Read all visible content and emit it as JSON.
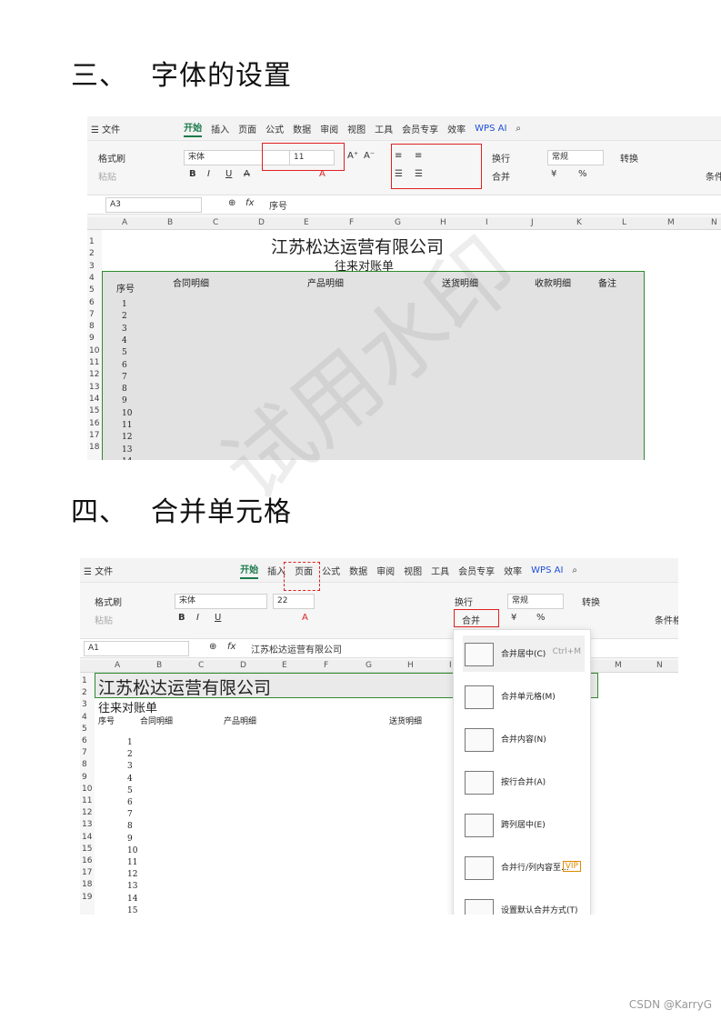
{
  "section1": {
    "num": "三、",
    "title": "字体的设置"
  },
  "section2": {
    "num": "四、",
    "title": "合并单元格"
  },
  "ribbon": {
    "menu": "☰ 文件",
    "tabs": [
      "开始",
      "插入",
      "页面",
      "公式",
      "数据",
      "审阅",
      "视图",
      "工具",
      "会员专享",
      "效率"
    ],
    "wps_ai": "WPS AI",
    "format_painter": "格式刷",
    "paste": "粘贴",
    "font_name": "宋体",
    "font_size": "11",
    "font_size_2": "22",
    "wrap": "换行",
    "merge": "合并",
    "number_format": "常规",
    "convert": "转换",
    "cond_format": "条件格",
    "yen": "¥",
    "percent": "%"
  },
  "shot1": {
    "name_box": "A3",
    "fx": "fx",
    "formula": "序号",
    "columns": [
      "A",
      "B",
      "C",
      "D",
      "E",
      "F",
      "G",
      "H",
      "I",
      "J",
      "K",
      "L",
      "M",
      "N"
    ],
    "title": "江苏松达运营有限公司",
    "subtitle": "往来对账单",
    "headers": [
      "序号",
      "合同明细",
      "产品明细",
      "送货明细",
      "收款明细",
      "备注"
    ],
    "rows": [
      "1",
      "2",
      "3",
      "4",
      "5",
      "6",
      "7",
      "8",
      "9",
      "10",
      "11",
      "12",
      "13",
      "14",
      "15",
      "16",
      "17",
      "18"
    ],
    "numbers": [
      "1",
      "2",
      "3",
      "4",
      "5",
      "6",
      "7",
      "8",
      "9",
      "10",
      "11",
      "12",
      "13",
      "14"
    ]
  },
  "shot2": {
    "name_box": "A1",
    "fx": "fx",
    "formula": "江苏松达运营有限公司",
    "columns": [
      "A",
      "B",
      "C",
      "D",
      "E",
      "F",
      "G",
      "H",
      "I",
      "M",
      "N"
    ],
    "title": "江苏松达运营有限公司",
    "subtitle": "往来对账单",
    "headers": [
      "序号",
      "合同明细",
      "产品明细",
      "送货明细"
    ],
    "rows": [
      "1",
      "2",
      "3",
      "4",
      "5",
      "6",
      "7",
      "8",
      "9",
      "10",
      "11",
      "12",
      "13",
      "14",
      "15",
      "16",
      "17",
      "18",
      "19"
    ],
    "numbers": [
      "1",
      "2",
      "3",
      "4",
      "5",
      "6",
      "7",
      "8",
      "9",
      "10",
      "11",
      "12",
      "13",
      "14",
      "15"
    ],
    "menu": [
      {
        "label": "合并居中(C)",
        "shortcut": "Ctrl+M"
      },
      {
        "label": "合并单元格(M)",
        "shortcut": ""
      },
      {
        "label": "合并内容(N)",
        "shortcut": ""
      },
      {
        "label": "按行合并(A)",
        "shortcut": ""
      },
      {
        "label": "跨列居中(E)",
        "shortcut": ""
      },
      {
        "label": "合并行/列内容至...",
        "shortcut": "VIP"
      },
      {
        "label": "设置默认合并方式(T)",
        "shortcut": ""
      }
    ]
  },
  "watermark": "试用水印",
  "footer": "CSDN @KarryG",
  "colors": {
    "accent": "#1a7a4a",
    "highlight": "#e02020",
    "selection": "#2e8b2e"
  }
}
